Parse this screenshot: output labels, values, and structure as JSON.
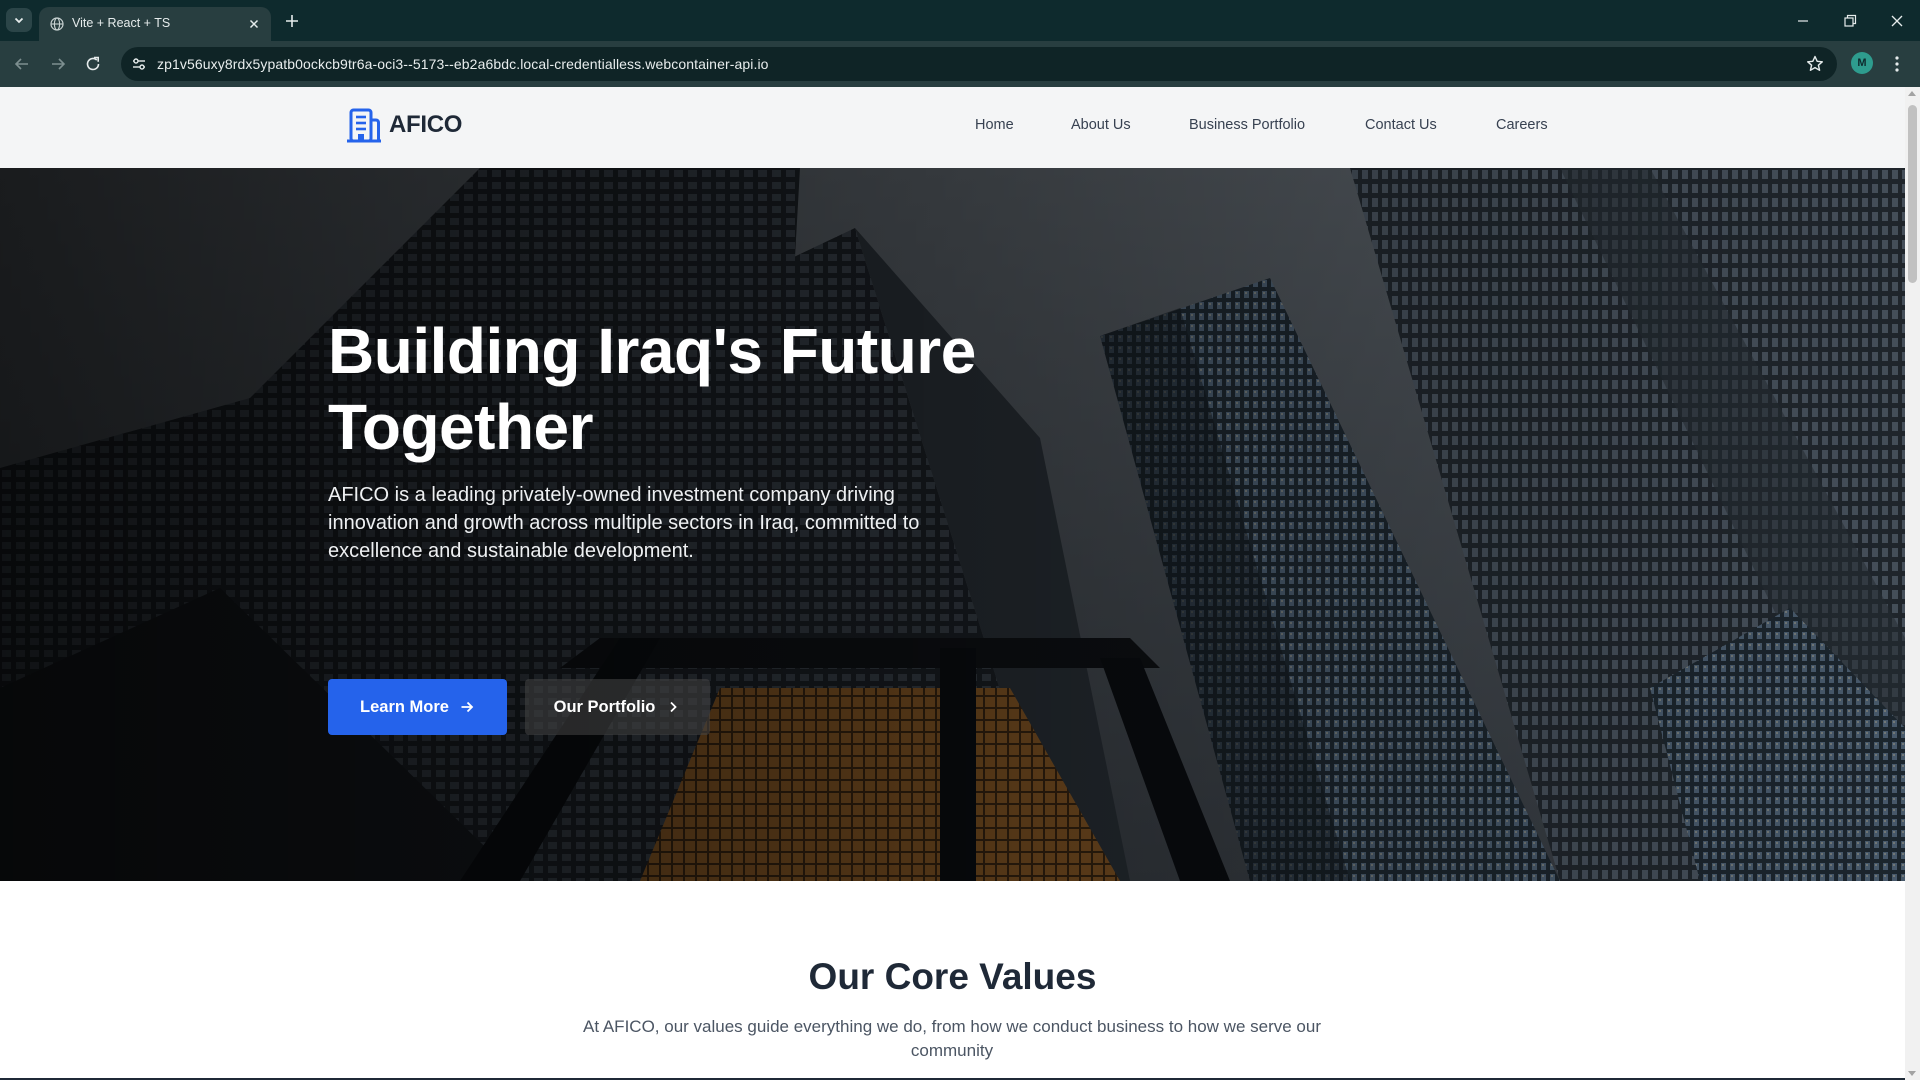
{
  "browser": {
    "tab_title": "Vite + React + TS",
    "url": "zp1v56uxy8rdx5ypatb0ockcb9tr6a-oci3--5173--eb2a6bdc.local-credentialless.webcontainer-api.io",
    "profile_initial": "M",
    "icons": {
      "tab_list": "chevron-down-icon",
      "favicon": "globe-icon",
      "close": "close-icon",
      "new_tab": "plus-icon",
      "back": "arrow-left-icon",
      "forward": "arrow-right-icon",
      "reload": "reload-icon",
      "site_info": "tune-icon",
      "bookmark": "star-icon",
      "menu": "kebab-menu-icon"
    }
  },
  "site": {
    "logo_text": "AFICO",
    "logo_icon": "building-icon",
    "accent_color": "#2563eb",
    "nav": [
      {
        "label": "Home"
      },
      {
        "label": "About Us"
      },
      {
        "label": "Business Portfolio"
      },
      {
        "label": "Contact Us"
      },
      {
        "label": "Careers"
      }
    ]
  },
  "hero": {
    "title_line1": "Building Iraq's Future",
    "title_line2": "Together",
    "description": "AFICO is a leading privately-owned investment company driving innovation and growth across multiple sectors in Iraq, committed to excellence and sustainable development.",
    "primary_button": "Learn More",
    "secondary_button": "Our Portfolio"
  },
  "values": {
    "title": "Our Core Values",
    "description": "At AFICO, our values guide everything we do, from how we conduct business to how we serve our community"
  }
}
